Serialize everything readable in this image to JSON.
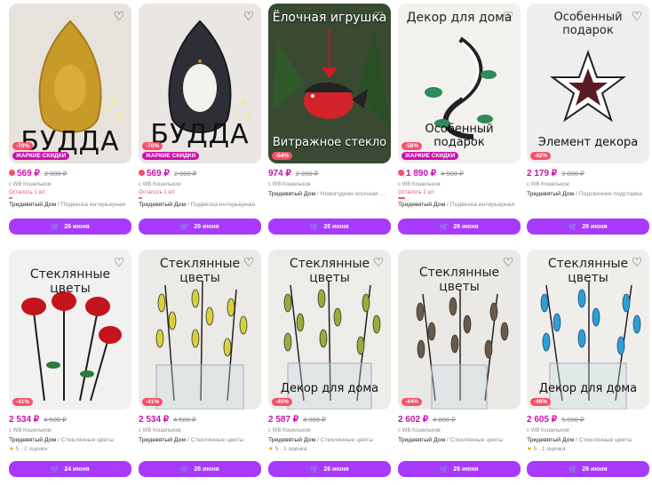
{
  "icons": {
    "favorite": "heart-outline-icon",
    "cart": "cart-icon",
    "rating": "star-icon"
  },
  "colors": {
    "accent": "#a73afd",
    "price": "#cb11ab",
    "discount": "#f5516c",
    "hot": "#cb11ab"
  },
  "products": [
    {
      "caption_top": "",
      "caption_big": "БУДДА",
      "caption_bottom": "",
      "discount": "-70%",
      "hot": "ЖАРКИЕ СКИДКИ",
      "price": "569 ₽",
      "old_price": "2 000 ₽",
      "wallet": "с WB Кошельком",
      "stock": "Осталось 1 шт",
      "brand": "Тридевятый Дом",
      "name": " / Подвеска интерьерная",
      "rating": "",
      "reviews": "",
      "delivery": "26 июня"
    },
    {
      "caption_top": "",
      "caption_big": "БУДДА",
      "caption_bottom": "",
      "discount": "-70%",
      "hot": "ЖАРКИЕ СКИДКИ",
      "price": "569 ₽",
      "old_price": "2 000 ₽",
      "wallet": "с WB Кошельком",
      "stock": "Осталось 1 шт",
      "brand": "Тридевятый Дом",
      "name": " / Подвеска интерьерная",
      "rating": "",
      "reviews": "",
      "delivery": "26 июня"
    },
    {
      "caption_top": "Ёлочная игрушка",
      "caption_big": "",
      "caption_bottom": "Витражное стекло",
      "discount": "-54%",
      "hot": "",
      "price": "974 ₽",
      "old_price": "2 200 ₽",
      "wallet": "с WB Кошельком",
      "stock": "",
      "brand": "Тридевятый Дом",
      "name": " / Новогодняя елочная ...",
      "rating": "",
      "reviews": "",
      "delivery": "26 июня"
    },
    {
      "caption_top": "Декор для дома",
      "caption_big": "",
      "caption_bottom": "Особенный подарок",
      "discount": "-58%",
      "hot": "ЖАРКИЕ СКИДКИ",
      "price": "1 890 ₽",
      "old_price": "4 500 ₽",
      "wallet": "с WB Кошельком",
      "stock": "Осталось 2 шт",
      "brand": "Тридевятый Дом",
      "name": " / Подвеска интерьерная",
      "rating": "",
      "reviews": "",
      "delivery": "26 июня"
    },
    {
      "caption_top": "Особенный подарок",
      "caption_big": "",
      "caption_bottom": "Элемент декора",
      "discount": "-42%",
      "hot": "",
      "price": "2 179 ₽",
      "old_price": "3 800 ₽",
      "wallet": "с WB Кошельком",
      "stock": "",
      "brand": "Тридевятый Дом",
      "name": " / Подсвечник подставка",
      "rating": "",
      "reviews": "",
      "delivery": "26 июня"
    },
    {
      "caption_top": "Стеклянные цветы",
      "caption_big": "",
      "caption_bottom": "",
      "discount": "-41%",
      "hot": "",
      "price": "2 534 ₽",
      "old_price": "4 500 ₽",
      "wallet": "с WB Кошельком",
      "stock": "",
      "brand": "Тридевятый Дом",
      "name": " / Стеклянные цветы",
      "rating": "5",
      "reviews": "2 оценки",
      "delivery": "24 июня"
    },
    {
      "caption_top": "Стеклянные цветы",
      "caption_big": "",
      "caption_bottom": "",
      "discount": "-41%",
      "hot": "",
      "price": "2 534 ₽",
      "old_price": "4 500 ₽",
      "wallet": "с WB Кошельком",
      "stock": "",
      "brand": "Тридевятый Дом",
      "name": " / Стеклянные цветы",
      "rating": "",
      "reviews": "",
      "delivery": "26 июня"
    },
    {
      "caption_top": "Стеклянные цветы",
      "caption_big": "",
      "caption_bottom": "Декор для дома",
      "discount": "-45%",
      "hot": "",
      "price": "2 587 ₽",
      "old_price": "4 900 ₽",
      "wallet": "с WB Кошельком",
      "stock": "",
      "brand": "Тридевятый Дом",
      "name": " / Стеклянные цветы",
      "rating": "5",
      "reviews": "1 оценка",
      "delivery": "26 июня"
    },
    {
      "caption_top": "Стеклянные цветы",
      "caption_big": "",
      "caption_bottom": "",
      "discount": "-44%",
      "hot": "",
      "price": "2 602 ₽",
      "old_price": "4 800 ₽",
      "wallet": "с WB Кошельком",
      "stock": "",
      "brand": "Тридевятый Дом",
      "name": " / Стеклянные цветы",
      "rating": "",
      "reviews": "",
      "delivery": "26 июня"
    },
    {
      "caption_top": "Стеклянные цветы",
      "caption_big": "",
      "caption_bottom": "Декор для дома",
      "discount": "-46%",
      "hot": "",
      "price": "2 605 ₽",
      "old_price": "5 000 ₽",
      "wallet": "с WB Кошельком",
      "stock": "",
      "brand": "Тридевятый Дом",
      "name": " / Стеклянные цветы",
      "rating": "5",
      "reviews": "1 оценка",
      "delivery": "26 июня"
    }
  ]
}
